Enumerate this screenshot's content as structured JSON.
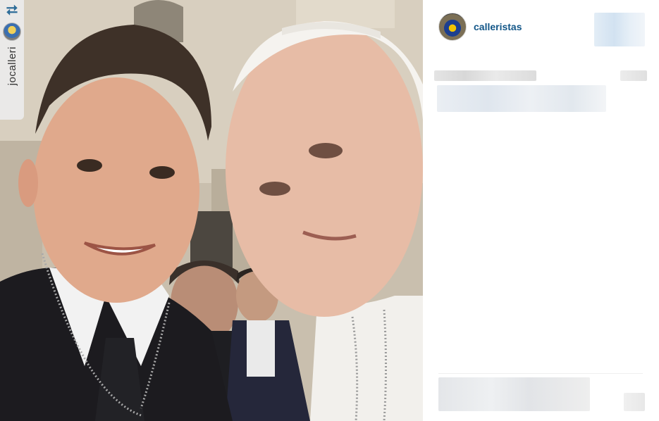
{
  "post": {
    "username": "calleristas",
    "repost": {
      "icon": "repost-icon",
      "original_user": "jocalleri"
    },
    "colors": {
      "username": "#125688",
      "repost_icon": "#2e6d99",
      "background": "#ffffff"
    }
  }
}
